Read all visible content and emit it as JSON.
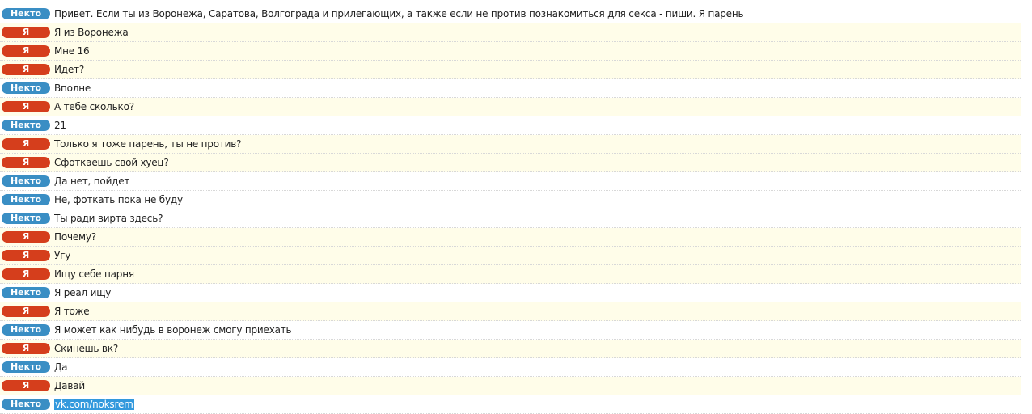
{
  "labels": {
    "them": "Некто",
    "me": "Я"
  },
  "colors": {
    "them_badge": "#3a8ec4",
    "me_badge": "#d53e1c",
    "me_row_bg": "#fffde9",
    "selection": "#3399dd"
  },
  "messages": [
    {
      "from": "them",
      "text": "Привет. Если ты из Воронежа, Саратова, Волгограда и прилегающих, а также если не против познакомиться для секса - пиши. Я парень"
    },
    {
      "from": "me",
      "text": "Я из Воронежа"
    },
    {
      "from": "me",
      "text": "Мне 16"
    },
    {
      "from": "me",
      "text": "Идет?"
    },
    {
      "from": "them",
      "text": "Вполне"
    },
    {
      "from": "me",
      "text": "А тебе сколько?"
    },
    {
      "from": "them",
      "text": "21"
    },
    {
      "from": "me",
      "text": "Только я тоже парень, ты не против?"
    },
    {
      "from": "me",
      "text": "Сфоткаешь свой хуец?"
    },
    {
      "from": "them",
      "text": "Да нет, пойдет"
    },
    {
      "from": "them",
      "text": "Не, фоткать пока не буду"
    },
    {
      "from": "them",
      "text": "Ты ради вирта здесь?"
    },
    {
      "from": "me",
      "text": "Почему?"
    },
    {
      "from": "me",
      "text": "Угу"
    },
    {
      "from": "me",
      "text": "Ищу себе парня"
    },
    {
      "from": "them",
      "text": "Я реал ищу"
    },
    {
      "from": "me",
      "text": "Я тоже"
    },
    {
      "from": "them",
      "text": "Я может как нибудь в воронеж смогу приехать"
    },
    {
      "from": "me",
      "text": "Скинешь вк?"
    },
    {
      "from": "them",
      "text": "Да"
    },
    {
      "from": "me",
      "text": "Давай"
    },
    {
      "from": "them",
      "text": "vk.com/noksrem",
      "selected": true
    }
  ]
}
